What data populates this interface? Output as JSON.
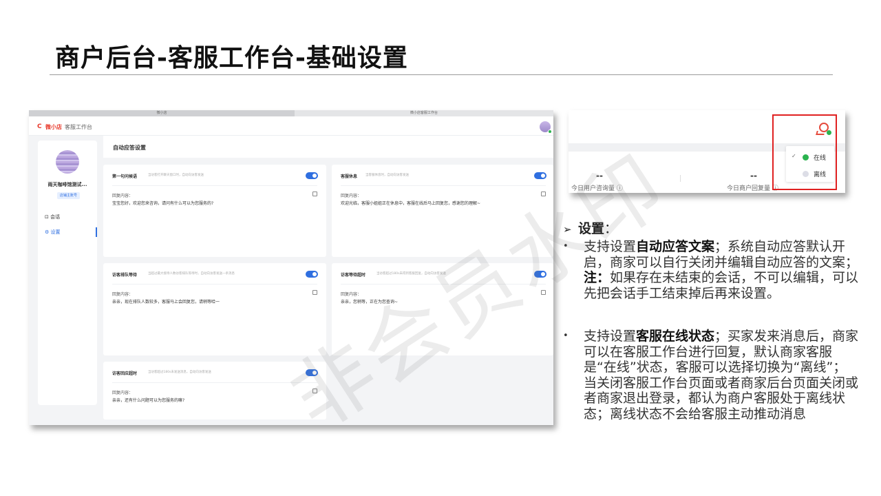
{
  "slide": {
    "title": "商户后台-客服工作台-基础设置",
    "watermark": "非会员水印"
  },
  "main_screenshot": {
    "browser_tabs": [
      "微小店",
      "微小店客服工作台"
    ],
    "header": {
      "logo_icon": "C",
      "logo_text": "微小店",
      "app_name": "客服工作台"
    },
    "sidebar": {
      "shop_name": "雨天咖啡馆测试...",
      "account_badge": "店铺主账号",
      "nav": [
        {
          "icon": "chat-icon",
          "label": "会话"
        },
        {
          "icon": "gear-icon",
          "label": "设置"
        }
      ]
    },
    "section_title": "自动应答设置",
    "cards": [
      {
        "title": "第一句问候语",
        "hint": "当访客打开聊天窗口时，自动向访客发送",
        "reply_label": "回复内容：",
        "reply_text": "宝宝您好，欢迎您来咨询，请问有什么可以为您服务的?",
        "enabled": true
      },
      {
        "title": "客服休息",
        "hint": "当客服休息时，自动向访客发送",
        "reply_label": "回复内容：",
        "reply_text": "欢迎光临，客服小姐姐正在休息中，客服在线后马上回复您，感谢您的理解~",
        "enabled": true
      },
      {
        "title": "访客排队等待",
        "hint": "当超过最大接待人数访客排队等待时，自动向访客发送一条消息",
        "reply_label": "回复内容：",
        "reply_text": "亲亲，现在排队人数较多，客服马上会回复您，请稍等哈一",
        "enabled": true
      },
      {
        "title": "访客等待超时",
        "hint": "当访客超过180s未得到客服回复，自动向访客发送",
        "reply_label": "回复内容：",
        "reply_text": "亲亲，您稍等，正在为您查询~",
        "enabled": true
      },
      {
        "title": "访客回应超时",
        "hint": "当访客超过180s未发送消息，自动向访客发送",
        "reply_label": "回复内容：",
        "reply_text": "亲亲，还有什么问题可以为您服务的嘛?",
        "enabled": true
      }
    ]
  },
  "status_screenshot": {
    "metrics": [
      {
        "value": "--",
        "label": "今日用户咨询量 ⓘ"
      },
      {
        "value": "--",
        "label": "今日商户回复量 ⓘ"
      }
    ],
    "menu": [
      {
        "label": "在线",
        "checked": true,
        "color": "#2bb34f"
      },
      {
        "label": "离线",
        "checked": false,
        "color": "#dcdde6"
      }
    ],
    "highlight_color": "#e02020"
  },
  "description": {
    "arrow": "➢",
    "heading": "设置",
    "heading_suffix": "：",
    "bullet_char": "•",
    "b1": {
      "p1": "支持设置",
      "h1": "自动应答文案",
      "p2": "；系统自动应答默认开启，商家可以自行关闭并编辑自动应答的文案；",
      "h2": "注：",
      "p3": "如果存在未结束的会话，不可以编辑，可以先把会话手工结束掉后再来设置。"
    },
    "b2": {
      "p1": "支持设置",
      "h1": "客服在线状态",
      "p2": "；买家发来消息后，商家可以在客服工作台进行回复，默认商家客服是“在线”状态，客服可以选择切换为“离线”；当关闭客服工作台页面或者商家后台页面关闭或者商家退出登录，都认为商户客服处于离线状态；离线状态不会给客服主动推动消息"
    }
  }
}
